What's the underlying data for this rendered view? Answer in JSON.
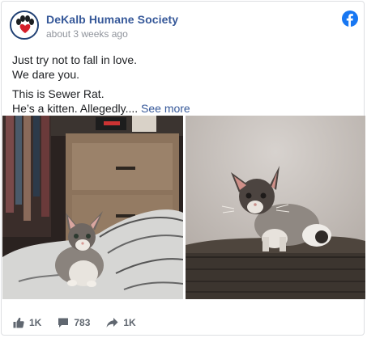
{
  "post": {
    "page_name": "DeKalb Humane Society",
    "timestamp": "about 3 weeks ago",
    "lines": [
      "Just try not to fall in love.",
      "We dare you.",
      "This is Sewer Rat.",
      "He’s a kitten. Allegedly...."
    ],
    "see_more": "See more"
  },
  "footer": {
    "likes": "1K",
    "comments": "783",
    "shares": "1K"
  },
  "colors": {
    "brand": "#1877f2",
    "link": "#365899",
    "muted": "#90949c"
  },
  "icons": {
    "avatar": "paw-heart-logo",
    "network": "facebook-icon",
    "like": "thumbs-up-icon",
    "comment": "comment-icon",
    "share": "share-arrow-icon"
  }
}
